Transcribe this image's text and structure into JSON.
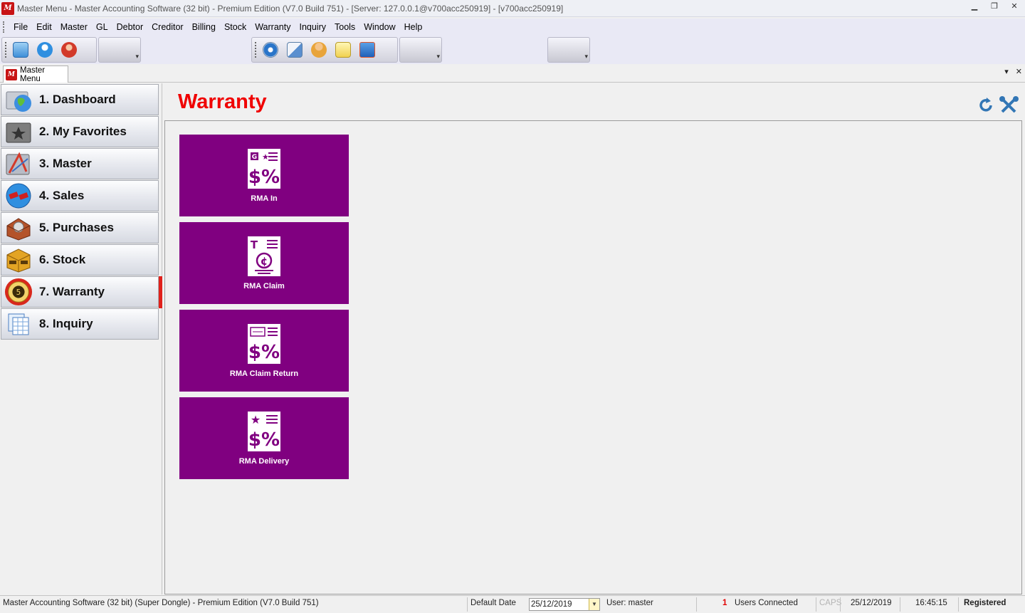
{
  "window": {
    "title": "Master Menu - Master Accounting Software (32 bit) - Premium Edition (V7.0 Build 751) - [Server: 127.0.0.1@v700acc250919] - [v700acc250919]",
    "controls": [
      "▁",
      "❐",
      "✕"
    ]
  },
  "menubar": {
    "items": [
      "File",
      "Edit",
      "Master",
      "GL",
      "Debtor",
      "Creditor",
      "Billing",
      "Stock",
      "Warranty",
      "Inquiry",
      "Tools",
      "Window",
      "Help"
    ]
  },
  "tab": {
    "label": "Master Menu"
  },
  "sidebar": {
    "items": [
      {
        "label": "1. Dashboard",
        "icon": "globe-folder-icon"
      },
      {
        "label": "2. My Favorites",
        "icon": "star-folder-icon"
      },
      {
        "label": "3. Master",
        "icon": "design-tools-icon"
      },
      {
        "label": "4. Sales",
        "icon": "sales-disc-icon"
      },
      {
        "label": "5. Purchases",
        "icon": "purchases-box-icon"
      },
      {
        "label": "6. Stock",
        "icon": "stock-box-icon"
      },
      {
        "label": "7. Warranty",
        "icon": "warranty-seal-icon",
        "active": true
      },
      {
        "label": "8. Inquiry",
        "icon": "inquiry-sheets-icon"
      }
    ]
  },
  "main": {
    "title": "Warranty",
    "tiles": [
      {
        "label": "RMA In",
        "icon": "rma-in-icon"
      },
      {
        "label": "RMA Claim",
        "icon": "rma-claim-icon"
      },
      {
        "label": "RMA Claim Return",
        "icon": "rma-claim-return-icon"
      },
      {
        "label": "RMA Delivery",
        "icon": "rma-delivery-icon"
      }
    ],
    "tile_color": "#800080",
    "title_color": "#f00000"
  },
  "statusbar": {
    "app_info": "Master Accounting Software (32 bit) (Super Dongle) - Premium Edition (V7.0 Build 751)",
    "default_date_label": "Default Date",
    "default_date_value": "25/12/2019",
    "user": "User: master",
    "users_connected_count": "1",
    "users_connected_label": "Users Connected",
    "caps": "CAPS",
    "date": "25/12/2019",
    "time": "16:45:15",
    "registration": "Registered"
  }
}
